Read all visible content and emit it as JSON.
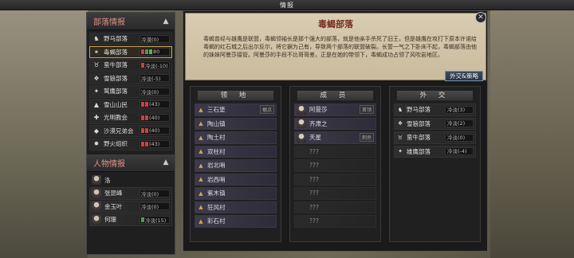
{
  "window": {
    "title": "情报",
    "close": "✕"
  },
  "sidebar": {
    "tribes_header": "部落情报",
    "tribes": [
      {
        "name": "野马部落",
        "relation": "冷漠(0)",
        "bars": [],
        "icon": "horse-icon"
      },
      {
        "name": "毒蝎部落",
        "relation": "80",
        "bars": [
          "#c04444",
          "#4aa04a",
          "#5ab05a"
        ],
        "icon": "scorpion-icon",
        "selected": true
      },
      {
        "name": "蛮牛部落",
        "relation": "冷淡(-10)",
        "bars": [
          "#c04444"
        ],
        "icon": "bull-icon"
      },
      {
        "name": "雪狼部落",
        "relation": "冷淡(-5)",
        "bars": [],
        "icon": "wolf-icon"
      },
      {
        "name": "鹫鹰部落",
        "relation": "冷淡(0)",
        "bars": [],
        "icon": "eagle-icon"
      },
      {
        "name": "雪山山民",
        "relation": "(43)",
        "bars": [
          "#c04444",
          "#c04444"
        ],
        "icon": "mountain-icon"
      },
      {
        "name": "光明教会",
        "relation": "(40)",
        "bars": [
          "#c04444",
          "#c04444"
        ],
        "icon": "church-icon"
      },
      {
        "name": "沙漠兄弟会",
        "relation": "(40)",
        "bars": [
          "#c04444",
          "#c04444"
        ],
        "icon": "desert-icon"
      },
      {
        "name": "野火组织",
        "relation": "(43)",
        "bars": [
          "#c04444",
          "#c04444"
        ],
        "icon": "fire-icon"
      }
    ],
    "people_header": "人物情报",
    "people": [
      {
        "name": "洛",
        "relation": ""
      },
      {
        "name": "张昆峰",
        "relation": "冷淡(0)"
      },
      {
        "name": "金玉叶",
        "relation": "冷淡(0)"
      },
      {
        "name": "何珊",
        "relation": "冷淡(15)",
        "bars": [
          "#4aa04a"
        ]
      }
    ]
  },
  "tribe_detail": {
    "title": "毒蝎部落",
    "description": "毒蝎曾经与雄鹰是联盟，毒蝎领袖长是那个强大的部落，就是他亲手杀死了旧王，但是雄鹰在攻打下原本许诺给毒蝎的红石城之后出尔反尔，将它据为己有，导致两个部落的联盟破裂。长誓一气之下卧床不起，毒蝎部落由他的妹妹阿曼莎接管。阿曼莎的手段不比哥哥差，正是在她的带领下，毒蝎成功占领了风吹岩地区。",
    "diplomacy_button": "外交&策略"
  },
  "territory": {
    "header": "领 地",
    "items": [
      {
        "name": "三石堡",
        "tag": "据点"
      },
      {
        "name": "陶山镇"
      },
      {
        "name": "陶土村"
      },
      {
        "name": "双柱村"
      },
      {
        "name": "岩北哨"
      },
      {
        "name": "岩西哨"
      },
      {
        "name": "紫木镇"
      },
      {
        "name": "狂风村"
      },
      {
        "name": "彩石村"
      }
    ]
  },
  "members": {
    "header": "成 员",
    "items": [
      {
        "name": "阿曼莎",
        "tag": "首领",
        "known": true
      },
      {
        "name": "齐肃之",
        "tag": "",
        "known": true
      },
      {
        "name": "天星",
        "tag": "刺杀",
        "known": true
      },
      {
        "name": "???",
        "known": false
      },
      {
        "name": "???",
        "known": false
      },
      {
        "name": "???",
        "known": false
      },
      {
        "name": "???",
        "known": false
      },
      {
        "name": "???",
        "known": false
      },
      {
        "name": "???",
        "known": false
      }
    ]
  },
  "diplomacy": {
    "header": "外 交",
    "items": [
      {
        "name": "野马部落",
        "relation": "冷淡(3)"
      },
      {
        "name": "雪狼部落",
        "relation": "冷淡(2)"
      },
      {
        "name": "蛮牛部落",
        "relation": "冷淡(0)"
      },
      {
        "name": "雄鹰部落",
        "relation": "冷淡(-4)"
      }
    ]
  }
}
